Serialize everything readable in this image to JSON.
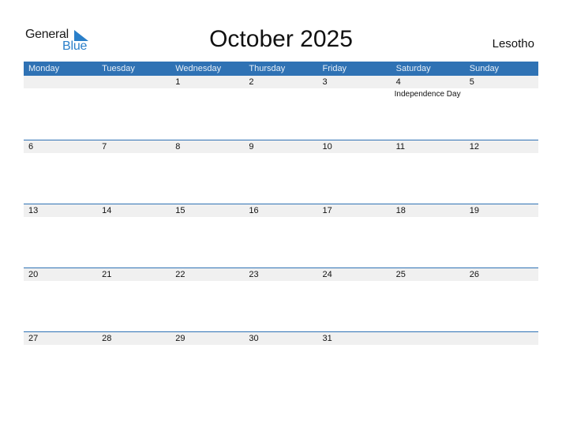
{
  "logo": {
    "word1": "General",
    "word2": "Blue"
  },
  "title": "October 2025",
  "country": "Lesotho",
  "colors": {
    "header_bg": "#2f72b4",
    "logo_blue": "#2a7fc9",
    "day_band": "#f0f0f0"
  },
  "weekdays": [
    "Monday",
    "Tuesday",
    "Wednesday",
    "Thursday",
    "Friday",
    "Saturday",
    "Sunday"
  ],
  "weeks": [
    [
      {
        "d": ""
      },
      {
        "d": ""
      },
      {
        "d": "1"
      },
      {
        "d": "2"
      },
      {
        "d": "3"
      },
      {
        "d": "4",
        "event": "Independence Day"
      },
      {
        "d": "5"
      }
    ],
    [
      {
        "d": "6"
      },
      {
        "d": "7"
      },
      {
        "d": "8"
      },
      {
        "d": "9"
      },
      {
        "d": "10"
      },
      {
        "d": "11"
      },
      {
        "d": "12"
      }
    ],
    [
      {
        "d": "13"
      },
      {
        "d": "14"
      },
      {
        "d": "15"
      },
      {
        "d": "16"
      },
      {
        "d": "17"
      },
      {
        "d": "18"
      },
      {
        "d": "19"
      }
    ],
    [
      {
        "d": "20"
      },
      {
        "d": "21"
      },
      {
        "d": "22"
      },
      {
        "d": "23"
      },
      {
        "d": "24"
      },
      {
        "d": "25"
      },
      {
        "d": "26"
      }
    ],
    [
      {
        "d": "27"
      },
      {
        "d": "28"
      },
      {
        "d": "29"
      },
      {
        "d": "30"
      },
      {
        "d": "31"
      },
      {
        "d": ""
      },
      {
        "d": ""
      }
    ]
  ]
}
